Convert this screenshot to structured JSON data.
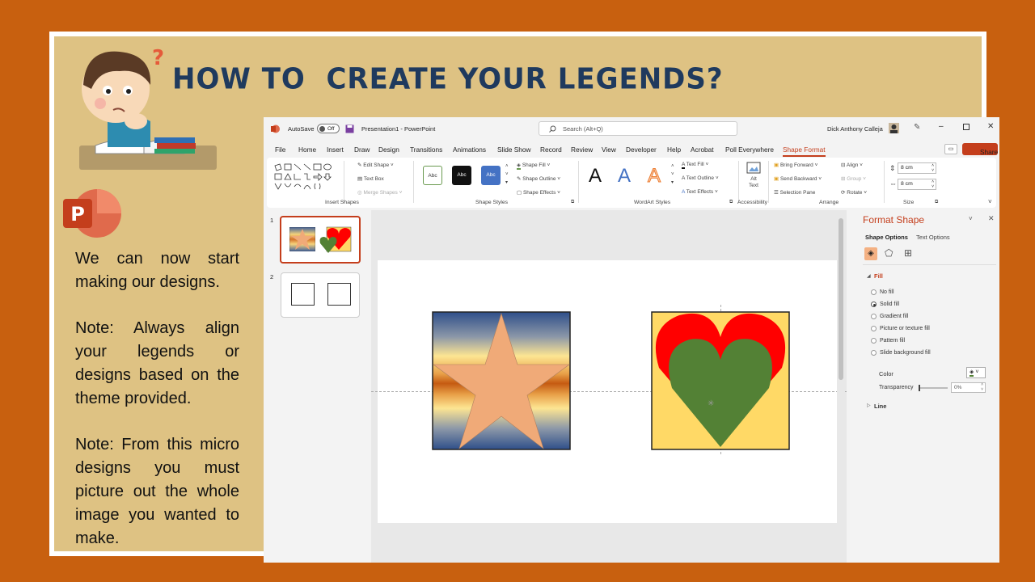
{
  "lesson": {
    "title": "HOW TO  CREATE YOUR LEGENDS?",
    "paragraphs": [
      "We can now start making our designs.",
      "Note: Always align your legends or designs based on the theme provided.",
      "Note: From this micro designs you must picture out the whole image you wanted to make."
    ]
  },
  "app": {
    "autosave_label": "AutoSave",
    "autosave_state": "Off",
    "doc_title": "Presentation1 - PowerPoint",
    "search_placeholder": "Search (Alt+Q)",
    "user_name": "Dick Anthony Calleja",
    "share_label": "Share",
    "menu": [
      "File",
      "Home",
      "Insert",
      "Draw",
      "Design",
      "Transitions",
      "Animations",
      "Slide Show",
      "Record",
      "Review",
      "View",
      "Developer",
      "Help",
      "Acrobat",
      "Poll Everywhere",
      "Shape Format"
    ],
    "active_menu": "Shape Format"
  },
  "ribbon": {
    "insert_shapes": {
      "edit_shape": "Edit Shape",
      "text_box": "Text Box",
      "merge_shapes": "Merge Shapes",
      "group_label": "Insert Shapes"
    },
    "shape_styles": {
      "abc": "Abc",
      "shape_fill": "Shape Fill",
      "shape_outline": "Shape Outline",
      "shape_effects": "Shape Effects",
      "group_label": "Shape Styles"
    },
    "wordart": {
      "letter": "A",
      "text_fill": "Text Fill",
      "text_outline": "Text Outline",
      "text_effects": "Text Effects",
      "group_label": "WordArt Styles"
    },
    "accessibility": {
      "alt_text_1": "Alt",
      "alt_text_2": "Text",
      "group_label": "Accessibility"
    },
    "arrange": {
      "bring_forward": "Bring Forward",
      "send_backward": "Send Backward",
      "selection_pane": "Selection Pane",
      "align": "Align",
      "group": "Group",
      "rotate": "Rotate",
      "group_label": "Arrange"
    },
    "size": {
      "height": "8 cm",
      "width": "8 cm",
      "group_label": "Size"
    }
  },
  "thumbnails": {
    "slide1_number": "1",
    "slide2_number": "2"
  },
  "format_pane": {
    "title": "Format Shape",
    "tab_shape": "Shape Options",
    "tab_text": "Text Options",
    "fill_header": "Fill",
    "fill_options": [
      "No fill",
      "Solid fill",
      "Gradient fill",
      "Picture or texture fill",
      "Pattern fill",
      "Slide background fill"
    ],
    "selected_fill": "Solid fill",
    "color_label": "Color",
    "transparency_label": "Transparency",
    "transparency_value": "0%",
    "line_header": "Line"
  },
  "colors": {
    "accent": "#c43e1c",
    "background": "#c8600f",
    "panel": "#dec283",
    "title_text": "#1f3a5e",
    "star": "#f0aa78",
    "heart_red": "#ff0000",
    "heart_green": "#538135",
    "square_yellow": "#ffd966"
  }
}
